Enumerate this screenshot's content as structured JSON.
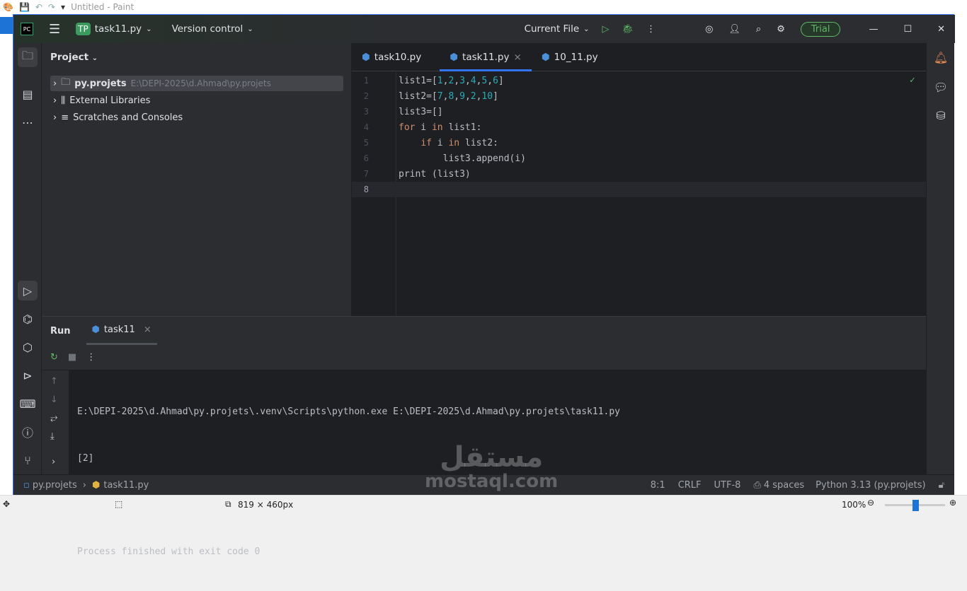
{
  "paint": {
    "title": "Untitled - Paint",
    "dimensions": "819 × 460px",
    "zoom": "100%",
    "zoom_fraction": 0.5
  },
  "titlebar": {
    "project_badge": "TP",
    "project": "task11.py",
    "vcs": "Version control",
    "run_config": "Current File",
    "trial": "Trial"
  },
  "project_panel": {
    "title": "Project",
    "items": [
      {
        "label": "py.projets",
        "path": "E:\\DEPI-2025\\d.Ahmad\\py.projets"
      },
      {
        "label": "External Libraries"
      },
      {
        "label": "Scratches and Consoles"
      }
    ]
  },
  "tabs": [
    {
      "label": "task10.py"
    },
    {
      "label": "task11.py",
      "close": "×"
    },
    {
      "label": "10_11.py"
    }
  ],
  "editor": {
    "line_numbers": [
      "1",
      "2",
      "3",
      "4",
      "5",
      "6",
      "7",
      "8"
    ]
  },
  "run": {
    "title": "Run",
    "tab": "task11",
    "close": "×",
    "output": [
      "E:\\DEPI-2025\\d.Ahmad\\py.projets\\.venv\\Scripts\\python.exe E:\\DEPI-2025\\d.Ahmad\\py.projets\\task11.py",
      "[2]",
      "",
      "Process finished with exit code 0"
    ]
  },
  "status": {
    "crumb_project": "py.projets",
    "crumb_file": "task11.py",
    "position": "8:1",
    "line_sep": "CRLF",
    "encoding": "UTF-8",
    "indent": "4 spaces",
    "interpreter": "Python 3.13 (py.projets)"
  },
  "watermark": {
    "arabic": "مستقل",
    "latin": "mostaql.com"
  }
}
